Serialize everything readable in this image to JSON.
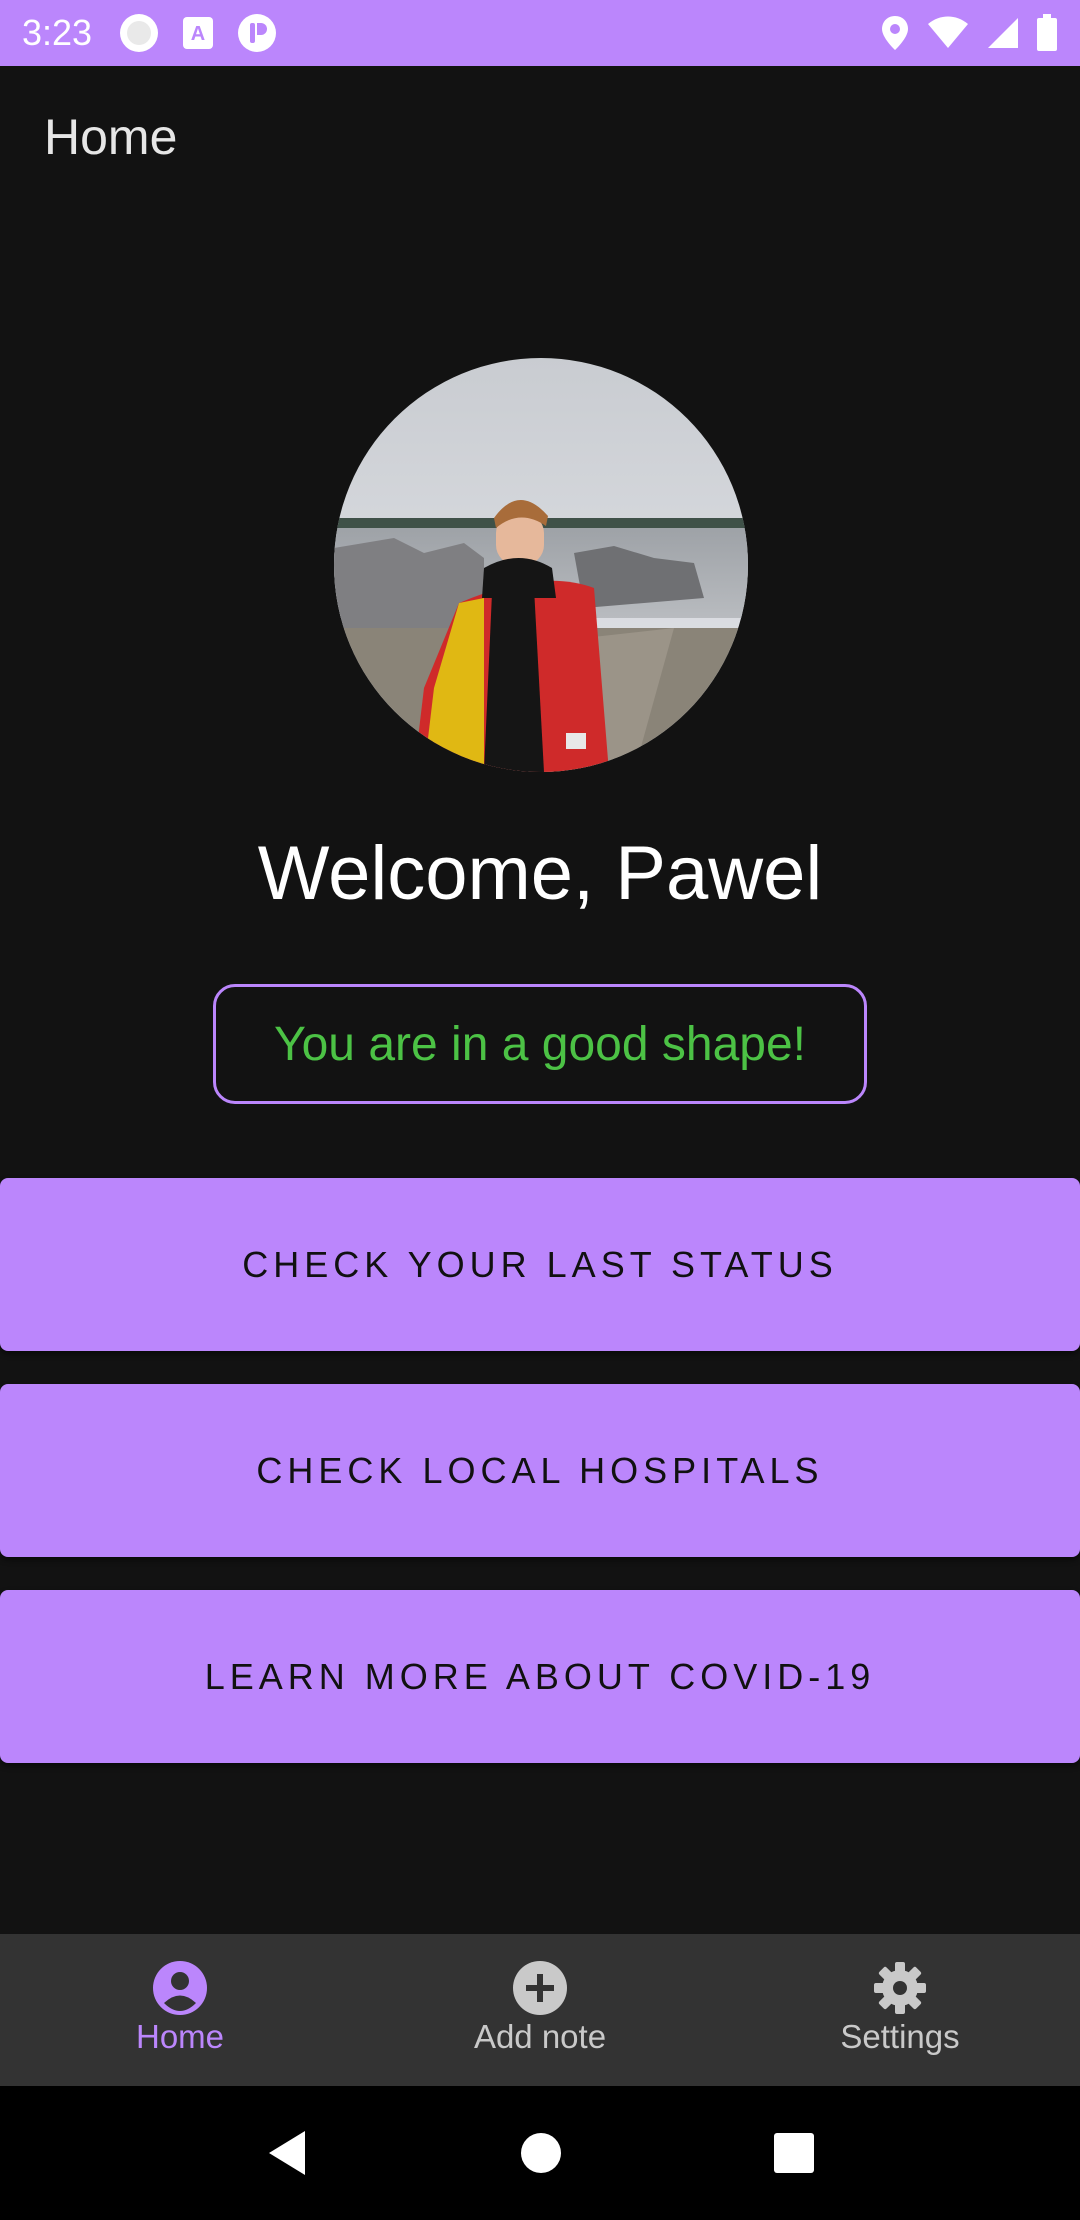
{
  "status_bar": {
    "time": "3:23",
    "left_icons": [
      "circle-notification-icon",
      "text-a-icon",
      "app-notification-icon"
    ],
    "right_icons": [
      "location-icon",
      "wifi-icon",
      "cell-signal-icon",
      "battery-icon"
    ]
  },
  "app_bar": {
    "title": "Home"
  },
  "profile": {
    "avatar_alt": "profile-photo",
    "welcome_text": "Welcome, Pawel",
    "health_status": "You are in a good shape!"
  },
  "actions": [
    {
      "label": "CHECK YOUR LAST STATUS"
    },
    {
      "label": "CHECK LOCAL HOSPITALS"
    },
    {
      "label": "LEARN MORE ABOUT COVID-19"
    }
  ],
  "bottom_nav": {
    "items": [
      {
        "label": "Home",
        "icon": "account-circle-icon",
        "active": true
      },
      {
        "label": "Add note",
        "icon": "add-circle-icon",
        "active": false
      },
      {
        "label": "Settings",
        "icon": "gear-icon",
        "active": false
      }
    ]
  },
  "colors": {
    "accent": "#BB86FC",
    "background": "#121212",
    "status_good": "#4CC245",
    "nav_background": "#333333"
  }
}
